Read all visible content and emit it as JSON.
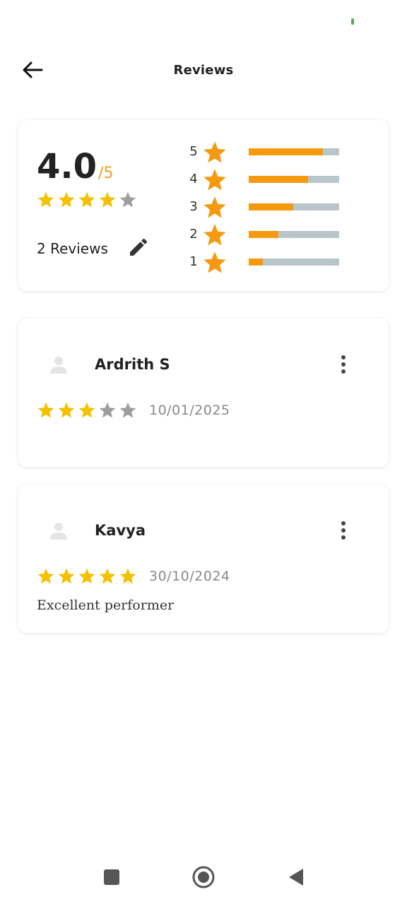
{
  "app": {
    "title": "Reviews"
  },
  "summary": {
    "average": "4.0",
    "max": "/5",
    "stars_filled": 4,
    "review_count_label": "2 Reviews",
    "distribution": [
      {
        "stars": "5",
        "fill": 0.82
      },
      {
        "stars": "4",
        "fill": 0.66
      },
      {
        "stars": "3",
        "fill": 0.49
      },
      {
        "stars": "2",
        "fill": 0.33
      },
      {
        "stars": "1",
        "fill": 0.16
      }
    ]
  },
  "reviews": [
    {
      "name": "Ardrith S",
      "rating": 3,
      "date": "10/01/2025",
      "comment": ""
    },
    {
      "name": "Kavya",
      "rating": 5,
      "date": "30/10/2024",
      "comment": "Excellent performer"
    }
  ],
  "colors": {
    "star_gold": "#f5c000",
    "star_grey": "#9e9e9e",
    "bar_orange": "#f59a10",
    "bar_track": "#b8c6cc",
    "accent_orange": "#f0a020"
  }
}
